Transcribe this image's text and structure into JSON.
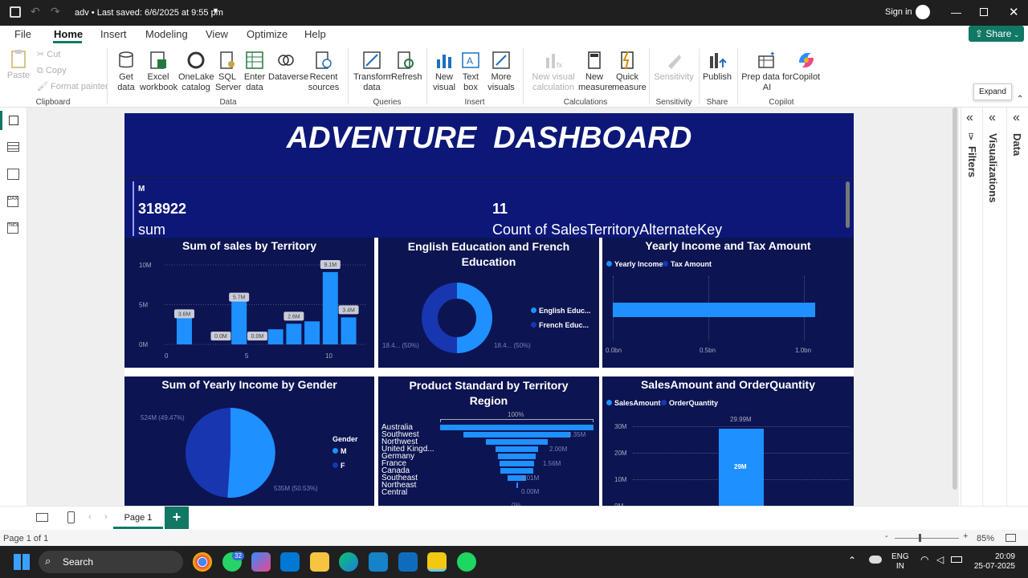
{
  "titlebar": {
    "file_title": "adv • Last saved: 6/6/2025 at 9:55 pm",
    "signin": "Sign in"
  },
  "menu": [
    "File",
    "Home",
    "Insert",
    "Modeling",
    "View",
    "Optimize",
    "Help"
  ],
  "share_label": "Share",
  "ribbon": {
    "clipboard": {
      "paste": "Paste",
      "cut": "Cut",
      "copy": "Copy",
      "format_painter": "Format painter",
      "group": "Clipboard"
    },
    "data": {
      "get_data": "Get data",
      "excel": "Excel workbook",
      "onelake": "OneLake catalog",
      "sql": "SQL Server",
      "enter": "Enter data",
      "dataverse": "Dataverse",
      "recent": "Recent sources",
      "group": "Data"
    },
    "queries": {
      "transform": "Transform data",
      "refresh": "Refresh",
      "group": "Queries"
    },
    "insert": {
      "new_visual": "New visual",
      "text_box": "Text box",
      "more_visuals": "More visuals",
      "group": "Insert"
    },
    "calculations": {
      "new_visual_calc": "New visual calculation",
      "new_measure": "New measure",
      "quick_measure": "Quick measure",
      "group": "Calculations"
    },
    "sensitivity": {
      "label": "Sensitivity",
      "group": "Sensitivity"
    },
    "share": {
      "publish": "Publish",
      "group": "Share"
    },
    "copilot": {
      "prep": "Prep data for AI",
      "copilot": "Copilot",
      "group": "Copilot"
    }
  },
  "expand_tooltip": "Expand",
  "panes": {
    "filters": "Filters",
    "visualizations": "Visualizations",
    "data": "Data"
  },
  "dashboard": {
    "title": "ADVENTURE  DASHBOARD",
    "card1": {
      "header": "M",
      "value": "318922",
      "label": "sum"
    },
    "card2": {
      "value": "11",
      "label": "Count of SalesTerritoryAlternateKey"
    },
    "v1": {
      "title": "Sum of sales by Territory"
    },
    "v2": {
      "title": "English Education and French Education",
      "legend": [
        "English Educ...",
        "French Educ..."
      ],
      "labels": [
        "18.4... (50%)",
        "18.4... (50%)"
      ]
    },
    "v3": {
      "title": "Yearly Income and Tax Amount",
      "legend": [
        "Yearly Income",
        "Tax Amount"
      ],
      "xticks": [
        "0.0bn",
        "0.5bn",
        "1.0bn"
      ]
    },
    "v4": {
      "title": "Sum of Yearly Income by Gender",
      "legend_title": "Gender",
      "legend": [
        "M",
        "F"
      ],
      "labels": [
        "524M (49.47%)",
        "535M (50.53%)"
      ]
    },
    "v5": {
      "title": "Product Standard by Territory Region",
      "top_label": "100%",
      "regions": [
        "Australia",
        "Southwest",
        "Northwest",
        "United Kingd...",
        "Germany",
        "France",
        "Canada",
        "Southeast",
        "Northeast",
        "Central"
      ],
      "value_labels": [
        "3.35M",
        "2.00M",
        "1.56M",
        "0.01M",
        "0.00M",
        "0%"
      ]
    },
    "v6": {
      "title": "SalesAmount and OrderQuantity",
      "legend": [
        "SalesAmount",
        "OrderQuantity"
      ],
      "yticks": [
        "30M",
        "20M",
        "10M",
        "0M"
      ],
      "bar_top": "29.99M",
      "bar_inner": "29M"
    }
  },
  "chart_data": [
    {
      "type": "bar",
      "title": "Sum of sales by Territory",
      "x": [
        1,
        2,
        3,
        4,
        5,
        6,
        7,
        8,
        9,
        10,
        11
      ],
      "values": [
        3.6,
        0.0,
        0.0,
        5.7,
        0.0,
        1.9,
        2.6,
        2.9,
        9.1,
        3.4,
        0
      ],
      "data_labels": [
        "3.6M",
        "0.0M",
        "5.7M",
        "0.0M",
        "2.6M",
        "9.1M",
        "3.4M"
      ],
      "yticks": [
        "0M",
        "5M",
        "10M"
      ],
      "xticks": [
        "0",
        "5",
        "10"
      ],
      "ylim": [
        0,
        10
      ]
    },
    {
      "type": "pie",
      "title": "English Education and French Education",
      "categories": [
        "English Educ...",
        "French Educ..."
      ],
      "values": [
        50,
        50
      ],
      "donut": true
    },
    {
      "type": "bar",
      "title": "Yearly Income and Tax Amount",
      "orientation": "horizontal",
      "series": [
        {
          "name": "Yearly Income",
          "values": [
            1.06
          ]
        },
        {
          "name": "Tax Amount",
          "values": [
            0
          ]
        }
      ],
      "xlim": [
        0,
        1.2
      ]
    },
    {
      "type": "pie",
      "title": "Sum of Yearly Income by Gender",
      "categories": [
        "M",
        "F"
      ],
      "values": [
        49.47,
        50.53
      ]
    },
    {
      "type": "bar",
      "title": "Product Standard by Territory Region",
      "orientation": "funnel",
      "categories": [
        "Australia",
        "Southwest",
        "Northwest",
        "United Kingd...",
        "Germany",
        "France",
        "Canada",
        "Southeast",
        "Northeast",
        "Central"
      ],
      "values": [
        100,
        70,
        40,
        28,
        25,
        23,
        21,
        12,
        0.3,
        0
      ]
    },
    {
      "type": "bar",
      "title": "SalesAmount and OrderQuantity",
      "series": [
        {
          "name": "SalesAmount",
          "values": [
            29.99
          ]
        }
      ],
      "ylim": [
        0,
        30
      ]
    }
  ],
  "pagebar": {
    "page_tab": "Page 1"
  },
  "status": {
    "page": "Page 1 of 1",
    "zoom": "85%"
  },
  "taskbar": {
    "search": "Search",
    "lang1": "ENG",
    "lang2": "IN",
    "time": "20:09",
    "date": "25-07-2025",
    "badge": "32"
  },
  "colors": {
    "navy": "#0c1452",
    "blue": "#1e90ff",
    "dark_blue": "#1836b0",
    "accent": "#117865"
  }
}
